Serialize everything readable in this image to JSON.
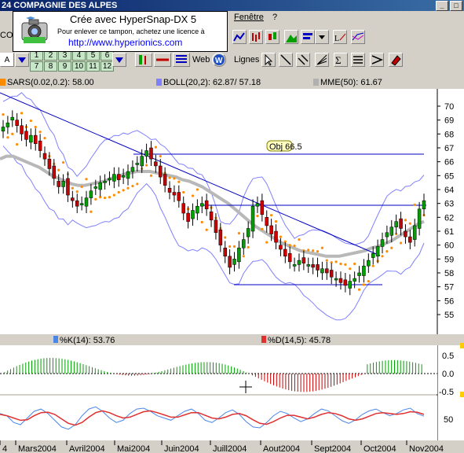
{
  "window": {
    "title": "24  COMPAGNIE DES ALPES"
  },
  "menu": {
    "window_label": "Fenêtre",
    "help_label": "?"
  },
  "stamp": {
    "line1": "Crée avec HyperSnap-DX 5",
    "line2": "Pour enlever ce tampon, achetez une licence à",
    "line3": "http://www.hyperionics.com"
  },
  "toolbar": {
    "left_fragment_top": "CO",
    "left_fragment_mid": "kT",
    "num_buttons": [
      "1",
      "2",
      "3",
      "4",
      "5",
      "6",
      "7",
      "8",
      "9",
      "10",
      "11",
      "12"
    ],
    "web_label": "Web",
    "lines_label": "Lignes",
    "letter_a": "A"
  },
  "legends": {
    "sar": "SARS(0.02,0.2): 58.00",
    "boll": "BOLL(20,2): 62.87/ 57.18",
    "mme": "MME(50): 61.67",
    "k": "%K(14): 53.76",
    "d": "%D(14,5): 45.78"
  },
  "colors": {
    "sar": "#ff8c00",
    "boll": "#8080ff",
    "mme": "#b0b0b0",
    "k": "#4a86e8",
    "d": "#e03030",
    "bull": "#00a000",
    "bear": "#cc0000"
  },
  "annotation": {
    "objective": "Obj 66.5"
  },
  "chart_data": [
    {
      "type": "line",
      "title": "",
      "y_ticks": [
        55,
        56,
        57,
        58,
        59,
        60,
        61,
        62,
        63,
        64,
        65,
        66,
        67,
        68,
        69,
        70
      ],
      "ylim": [
        54.5,
        71
      ],
      "x_labels": [
        "4",
        "Mars2004",
        "Avril2004",
        "Mai2004",
        "Juin2004",
        "Juill2004",
        "Aout2004",
        "Sept2004",
        "Oct2004",
        "Nov2004"
      ],
      "series": [
        {
          "name": "Close",
          "values": [
            68.5,
            68.8,
            69.2,
            68.6,
            68.0,
            67.6,
            67.9,
            67.3,
            66.8,
            66.2,
            65.5,
            64.8,
            64.2,
            64.6,
            63.6,
            63.2,
            62.8,
            63.0,
            63.4,
            63.9,
            64.2,
            64.5,
            64.6,
            64.8,
            65.1,
            64.7,
            65.0,
            65.3,
            65.6,
            65.9,
            66.4,
            66.8,
            66.2,
            65.7,
            64.9,
            64.3,
            63.8,
            63.6,
            63.2,
            62.3,
            61.7,
            62.5,
            62.8,
            63.0,
            62.6,
            61.8,
            60.9,
            60.0,
            59.2,
            58.4,
            59.0,
            59.8,
            60.4,
            61.2,
            62.8,
            63.0,
            62.2,
            61.4,
            60.8,
            60.2,
            59.7,
            59.2,
            58.8,
            58.6,
            58.9,
            58.7,
            58.6,
            58.4,
            58.2,
            58.3,
            58.0,
            57.7,
            57.6,
            57.3,
            57.1,
            57.4,
            57.6,
            58.0,
            58.5,
            58.9,
            59.4,
            59.9,
            60.4,
            60.9,
            61.3,
            61.7,
            61.2,
            60.6,
            60.2,
            61.4,
            62.6,
            63.2
          ]
        },
        {
          "name": "MME(50)",
          "values": [
            66.2,
            66.4,
            66.4,
            66.2,
            66.0,
            65.8,
            65.6,
            65.3,
            65.0,
            64.8,
            64.6,
            64.4,
            64.3,
            64.3,
            64.4,
            64.5,
            64.6,
            64.8,
            64.9,
            65.1,
            65.2,
            65.3,
            65.3,
            65.3,
            65.2,
            65.1,
            65.0,
            64.9,
            64.7,
            64.6,
            64.4,
            64.2,
            63.9,
            63.6,
            63.3,
            63.0,
            62.6,
            62.2,
            61.8,
            61.4,
            61.1,
            60.8,
            60.5,
            60.2,
            60.0,
            59.8,
            59.6,
            59.5,
            59.4,
            59.3,
            59.2,
            59.2,
            59.2,
            59.3,
            59.4,
            59.5,
            59.6,
            59.8,
            59.9,
            60.1,
            60.3,
            60.6,
            60.9,
            61.2,
            61.5,
            61.7
          ]
        },
        {
          "name": "%K(14)",
          "values": [
            60,
            55,
            40,
            35,
            50,
            65,
            70,
            60,
            45,
            30,
            25,
            35,
            55,
            70,
            75,
            65,
            50,
            40,
            45,
            60,
            70,
            72,
            65,
            55,
            50,
            45,
            55,
            65,
            70,
            60,
            45,
            40,
            50,
            62,
            68,
            58,
            42,
            30,
            28,
            40,
            55,
            65,
            60,
            50,
            42,
            48,
            60,
            70,
            66,
            55,
            44,
            38,
            46,
            58,
            66,
            70,
            62,
            55,
            60,
            68,
            72,
            60,
            54
          ]
        },
        {
          "name": "%D(14,5)",
          "values": [
            58,
            55,
            50,
            45,
            46,
            55,
            62,
            63,
            58,
            48,
            38,
            34,
            40,
            52,
            62,
            66,
            62,
            55,
            50,
            52,
            58,
            64,
            66,
            62,
            57,
            52,
            52,
            57,
            62,
            62,
            56,
            50,
            48,
            52,
            58,
            60,
            55,
            46,
            38,
            36,
            42,
            50,
            56,
            56,
            52,
            48,
            52,
            58,
            62,
            60,
            55,
            48,
            45,
            48,
            54,
            60,
            62,
            60,
            58,
            60,
            64,
            63,
            58
          ]
        }
      ]
    }
  ]
}
